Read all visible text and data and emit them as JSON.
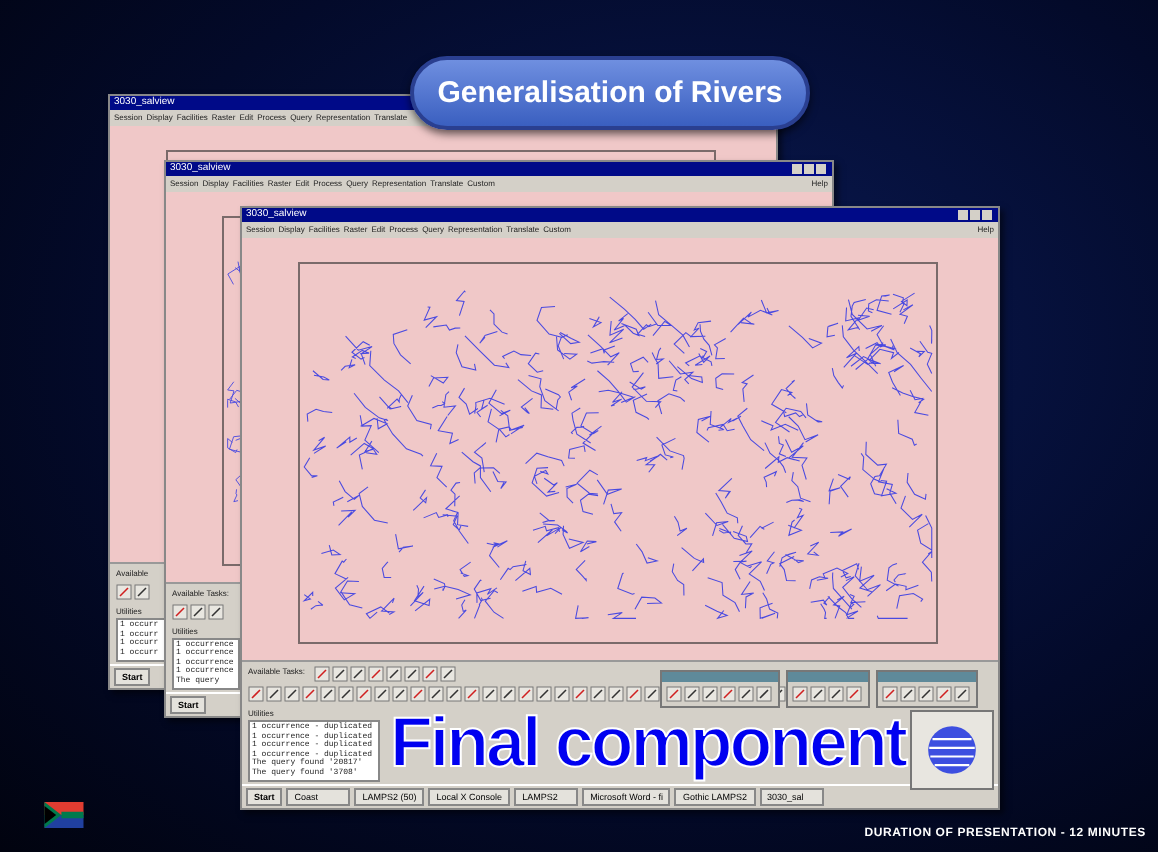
{
  "slide": {
    "title": "Generalisation of Rivers",
    "caption": "Final component",
    "footer": "DURATION OF PRESENTATION - 12 MINUTES"
  },
  "windows": [
    {
      "title": "3030_salview",
      "menus": [
        "Session",
        "Display",
        "Facilities",
        "Raster",
        "Edit",
        "Process",
        "Query",
        "Representation",
        "Translate"
      ],
      "tasks_label": "Available",
      "utilities": "Utilities",
      "console": [
        "1 occurr",
        "1 occurr",
        "1 occurr",
        "1 occurr"
      ],
      "taskbar": [
        "Start"
      ]
    },
    {
      "title": "3030_salview",
      "menus": [
        "Session",
        "Display",
        "Facilities",
        "Raster",
        "Edit",
        "Process",
        "Query",
        "Representation",
        "Translate",
        "Custom"
      ],
      "help": "Help",
      "tasks_label": "Available Tasks:",
      "utilities": "Utilities",
      "console": [
        "1 occurrence",
        "1 occurrence",
        "1 occurrence",
        "1 occurrence",
        "The query"
      ],
      "taskbar": [
        "Start"
      ]
    },
    {
      "title": "3030_salview",
      "menus": [
        "Session",
        "Display",
        "Facilities",
        "Raster",
        "Edit",
        "Process",
        "Query",
        "Representation",
        "Translate",
        "Custom"
      ],
      "help": "Help",
      "tasks_label": "Available Tasks:",
      "utilities": "Utilities",
      "console": [
        "1 occurrence - duplicated",
        "1 occurrence - duplicated",
        "1 occurrence - duplicated",
        "1 occurrence - duplicated",
        "The query found '20817'",
        "The query found '3708'"
      ],
      "taskbar": [
        "Start",
        "Coast",
        "LAMPS2 (50)",
        "Local X Console",
        "LAMPS2",
        "Microsoft Word - fi",
        "Gothic LAMPS2",
        "3030_sal"
      ]
    }
  ]
}
